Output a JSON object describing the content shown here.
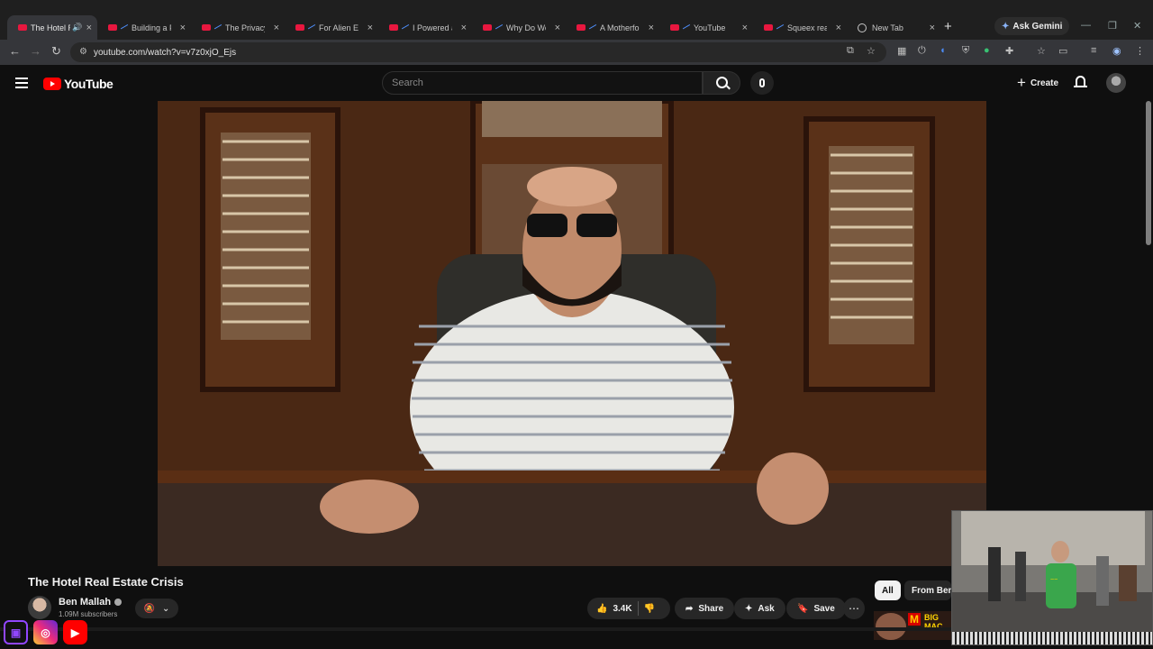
{
  "browser": {
    "tabs": [
      {
        "title": "The Hotel Re",
        "active": true,
        "icon": "youtube-favicon"
      },
      {
        "title": "Building a F",
        "icon": "youtube-favicon"
      },
      {
        "title": "The Privacy",
        "icon": "youtube-favicon"
      },
      {
        "title": "For Alien Ey",
        "icon": "youtube-favicon"
      },
      {
        "title": "I Powered a",
        "icon": "youtube-favicon"
      },
      {
        "title": "Why Do We",
        "icon": "youtube-favicon"
      },
      {
        "title": "A Motherfo",
        "icon": "youtube-favicon"
      },
      {
        "title": "YouTube",
        "icon": "youtube-favicon"
      },
      {
        "title": "Squeex rea",
        "icon": "youtube-favicon"
      },
      {
        "title": "New Tab",
        "icon": "globe-icon"
      }
    ],
    "gemini_label": "Ask Gemini",
    "url": "youtube.com/watch?v=v7z0xjO_Ejs"
  },
  "youtube": {
    "logo_text": "YouTube",
    "search_placeholder": "Search",
    "create_label": "Create"
  },
  "video": {
    "title": "The Hotel Real Estate Crisis",
    "channel_name": "Ben Mallah",
    "subscribers": "1.09M subscribers",
    "likes": "3.4K",
    "share_label": "Share",
    "ask_label": "Ask",
    "save_label": "Save"
  },
  "sidebar": {
    "chips": [
      "All",
      "From Ben M"
    ],
    "rec_thumb_text": "BIG MAC"
  },
  "colors": {
    "accent": "#ff0000",
    "tab_active": "#35363a",
    "bg": "#0f0f0f"
  }
}
